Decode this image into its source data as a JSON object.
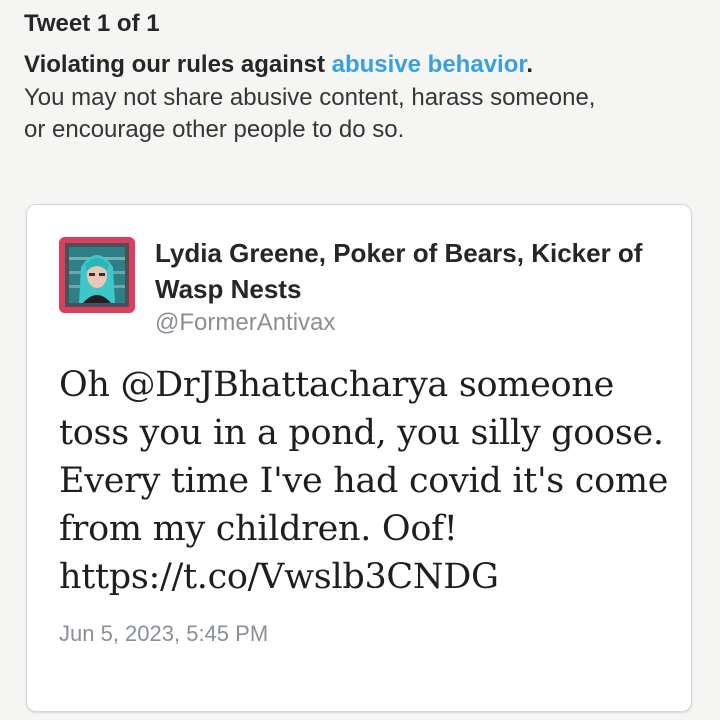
{
  "header": {
    "tweet_count": "Tweet 1 of 1",
    "violation_prefix": "Violating our rules against ",
    "violation_link": "abusive behavior",
    "violation_suffix": ".",
    "violation_desc_line1": "You may not share abusive content, harass someone,",
    "violation_desc_line2": "or encourage other people to do so."
  },
  "tweet": {
    "display_name": "Lydia Greene, Poker of Bears, Kicker of Wasp Nests",
    "handle": "@FormerAntivax",
    "text_lines": [
      "Oh @DrJBhattacharya someone",
      "toss you in a pond, you silly goose.",
      "Every time I've had covid it's come",
      "from my children. Oof!",
      "https://t.co/Vwslb3CNDG"
    ],
    "timestamp": "Jun 5, 2023, 5:45 PM"
  },
  "colors": {
    "link": "#3aa0e6",
    "avatar_bg": "#d9405f",
    "muted": "#8a8f94"
  },
  "icons": {
    "avatar": "user-avatar-portrait"
  }
}
